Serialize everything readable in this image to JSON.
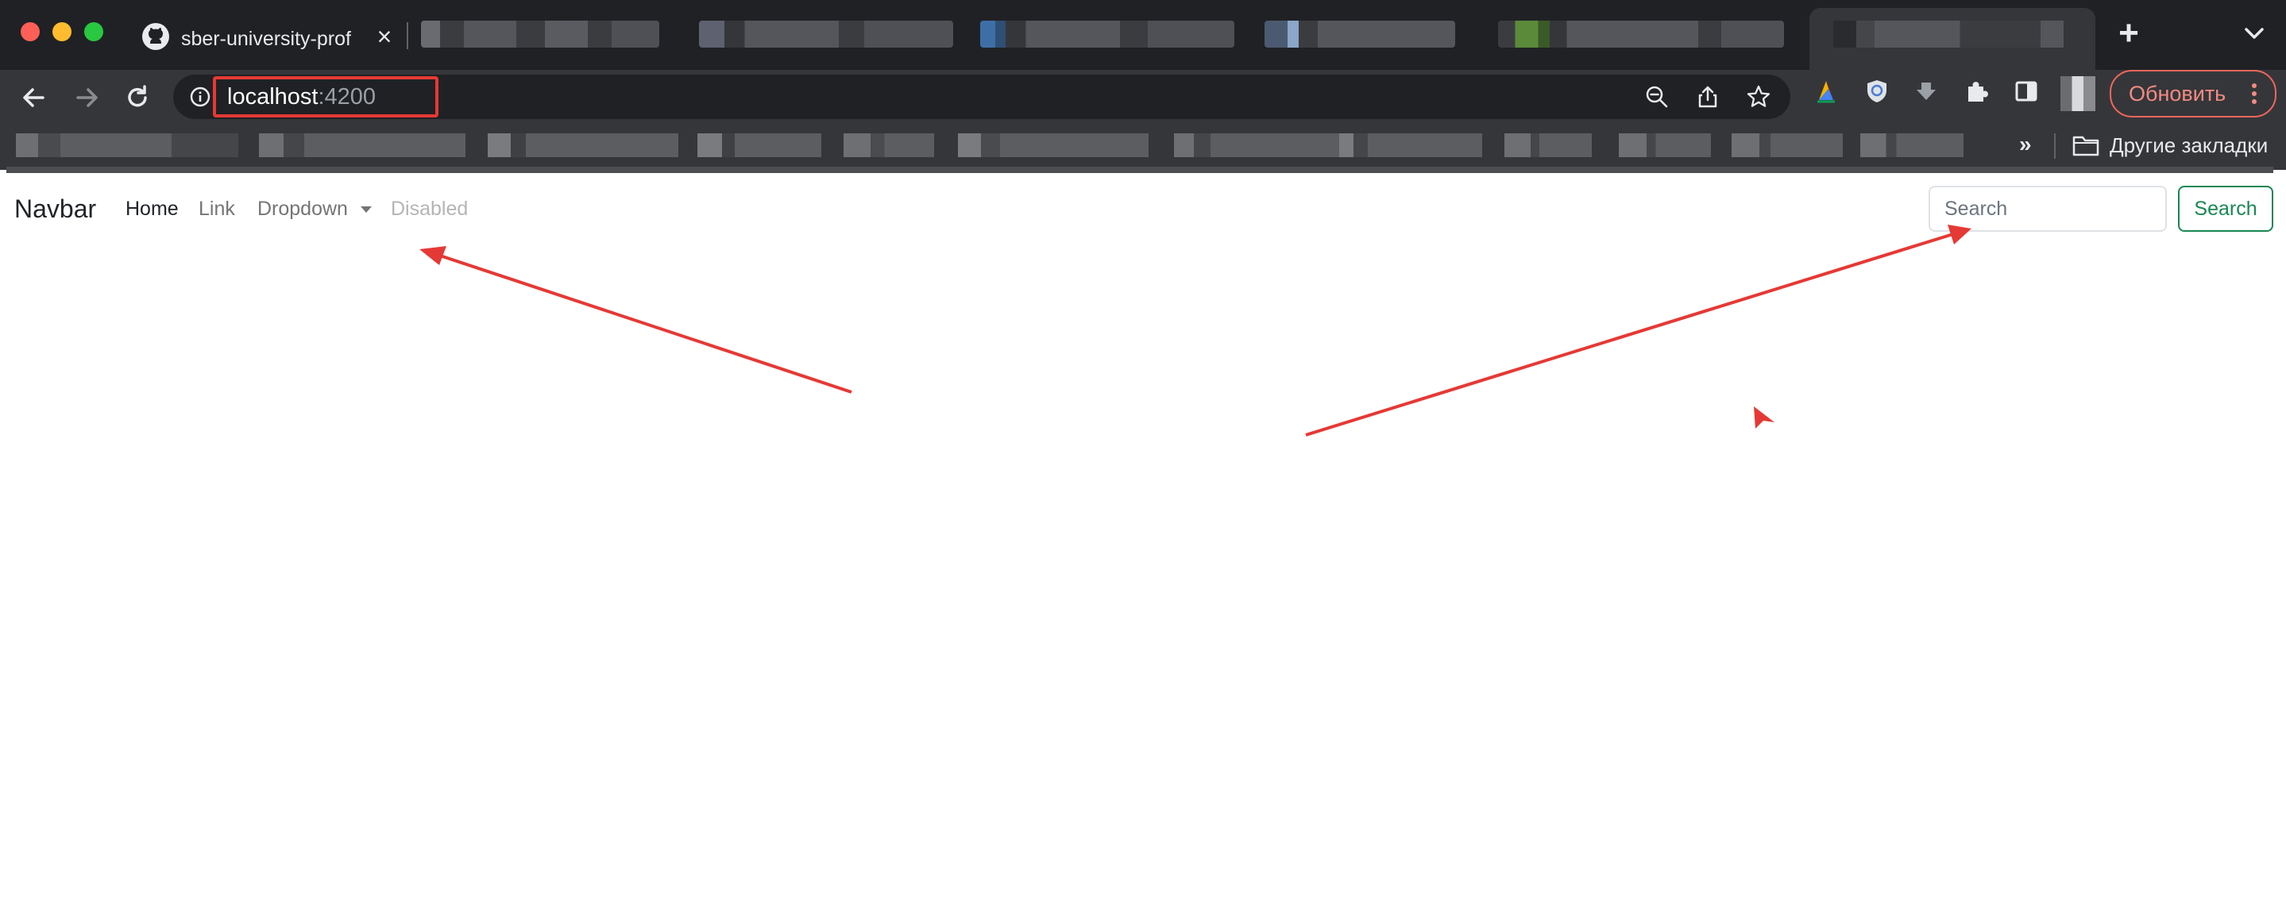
{
  "browser": {
    "active_tab": {
      "title": "sber-university-prof"
    },
    "address_bar": {
      "host": "localhost",
      "port": ":4200"
    },
    "update_button": "Обновить",
    "bookmarks": {
      "more_label": "»",
      "other_bookmarks": "Другие закладки"
    }
  },
  "navbar": {
    "brand": "Navbar",
    "links": {
      "home": "Home",
      "link": "Link",
      "dropdown": "Dropdown",
      "disabled": "Disabled"
    },
    "search": {
      "placeholder": "Search",
      "button": "Search"
    }
  },
  "colors": {
    "chrome_dark": "#202124",
    "toolbar": "#35363a",
    "annotation_red": "#e53935",
    "search_button_green": "#198754"
  }
}
